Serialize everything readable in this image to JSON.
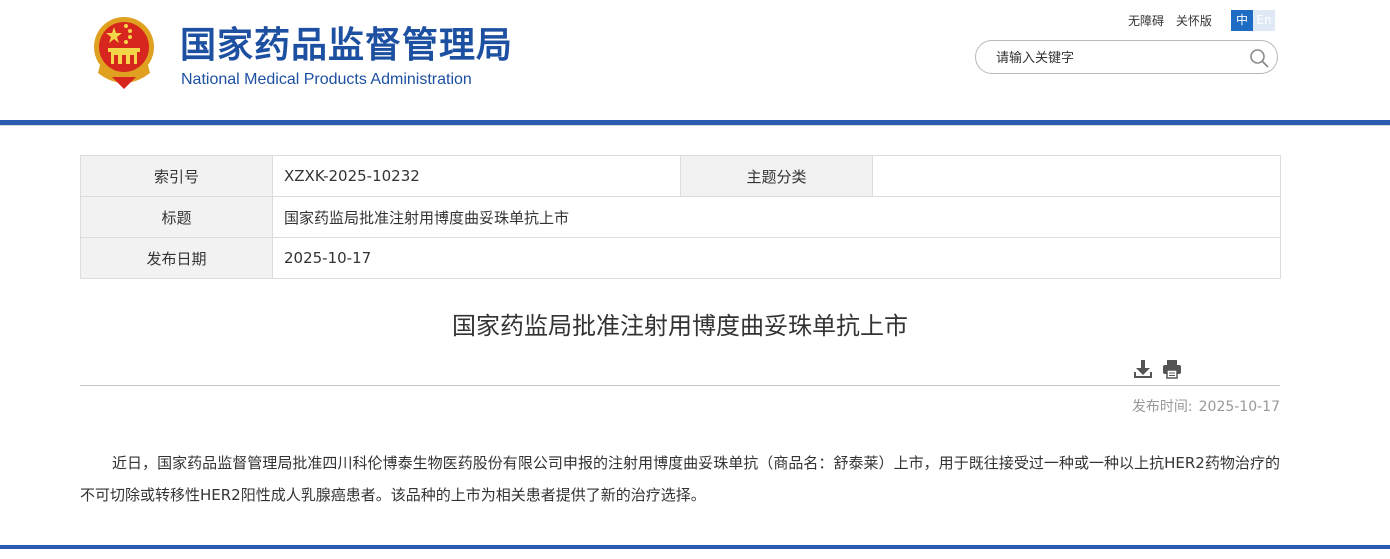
{
  "header": {
    "site_name_cn": "国家药品监督管理局",
    "site_name_en": "National Medical Products Administration",
    "accessibility_link": "无障碍",
    "elder_mode_link": "关怀版",
    "lang_zh": "中",
    "lang_en": "En",
    "search_placeholder": "请输入关键字",
    "brand_color": "#1e50a2"
  },
  "info_table": {
    "index_label": "索引号",
    "index_value": "XZXK-2025-10232",
    "topic_label": "主题分类",
    "topic_value": "",
    "title_label": "标题",
    "title_value": "国家药监局批准注射用博度曲妥珠单抗上市",
    "date_label": "发布日期",
    "date_value": "2025-10-17"
  },
  "article": {
    "title": "国家药监局批准注射用博度曲妥珠单抗上市",
    "publish_label": "发布时间:",
    "publish_date": "2025-10-17",
    "body": "近日，国家药品监督管理局批准四川科伦博泰生物医药股份有限公司申报的注射用博度曲妥珠单抗（商品名：舒泰莱）上市，用于既往接受过一种或一种以上抗HER2药物治疗的不可切除或转移性HER2阳性成人乳腺癌患者。该品种的上市为相关患者提供了新的治疗选择。"
  },
  "icons": {
    "download": "download-icon",
    "print": "print-icon",
    "search": "search-icon",
    "emblem": "national-emblem-icon"
  }
}
